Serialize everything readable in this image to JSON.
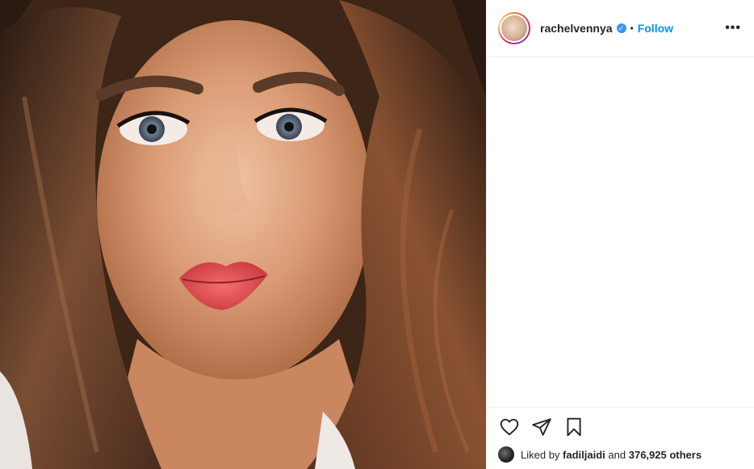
{
  "post": {
    "image": {
      "alt": "",
      "description_icon": "portrait-photo"
    },
    "author": {
      "username": "rachelvennya",
      "verified": true,
      "separator": "•",
      "follow_label": "Follow",
      "more_label": "•••"
    },
    "actions": {
      "like_icon": "heart-icon",
      "share_icon": "send-icon",
      "save_icon": "bookmark-icon"
    },
    "likes": {
      "prefix": "Liked by",
      "user": "fadiljaidi",
      "connector": "and",
      "others": "376,925 others"
    }
  },
  "colors": {
    "accent": "#0095f6",
    "verified": "#3897f0",
    "text": "#262626",
    "border": "#efefef"
  }
}
